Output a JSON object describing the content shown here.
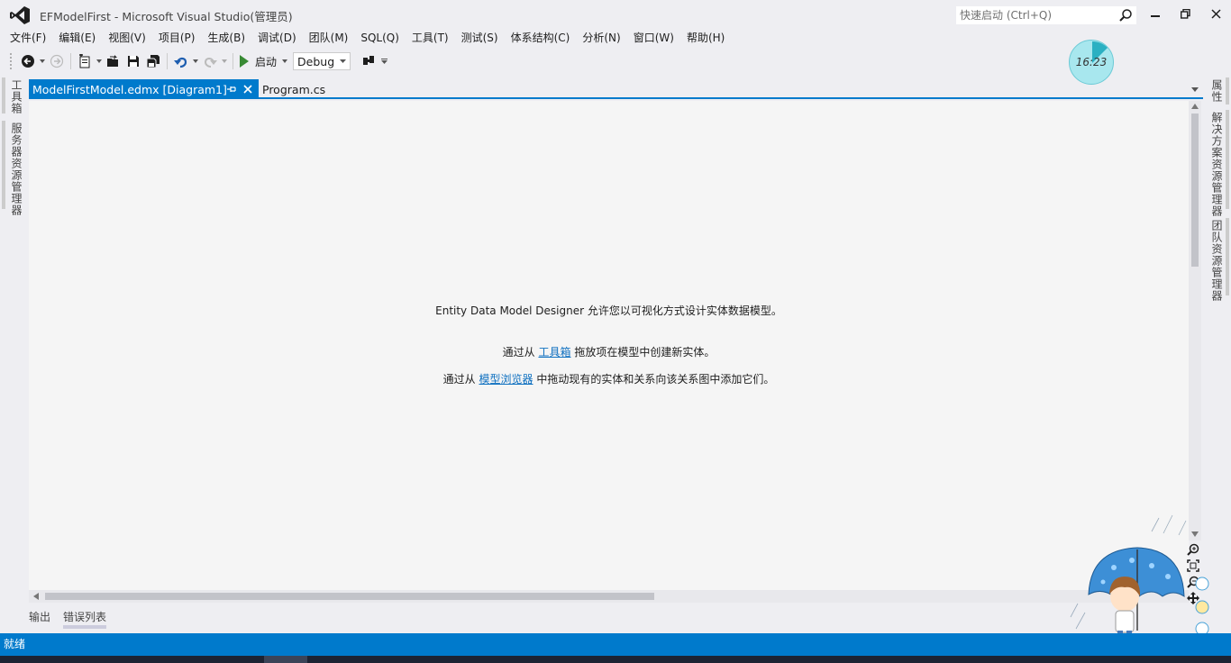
{
  "window": {
    "title": "EFModelFirst - Microsoft Visual Studio(管理员)",
    "quick_launch_placeholder": "快速启动 (Ctrl+Q)"
  },
  "menu": [
    "文件(F)",
    "编辑(E)",
    "视图(V)",
    "项目(P)",
    "生成(B)",
    "调试(D)",
    "团队(M)",
    "SQL(Q)",
    "工具(T)",
    "测试(S)",
    "体系结构(C)",
    "分析(N)",
    "窗口(W)",
    "帮助(H)"
  ],
  "toolbar": {
    "start_label": "启动",
    "configuration": "Debug"
  },
  "clock": {
    "time": "16:23"
  },
  "left_tool_windows": [
    "工具箱",
    "服务器资源管理器"
  ],
  "right_tool_windows": [
    "属性",
    "解决方案资源管理器",
    "团队资源管理器"
  ],
  "tabs": [
    {
      "label": "ModelFirstModel.edmx [Diagram1]",
      "active": true
    },
    {
      "label": "Program.cs",
      "active": false
    }
  ],
  "designer": {
    "line1": "Entity Data Model Designer 允许您以可视化方式设计实体数据模型。",
    "line2_prefix": "通过从 ",
    "line2_link": "工具箱",
    "line2_suffix": " 拖放项在模型中创建新实体。",
    "line3_prefix": "通过从 ",
    "line3_link": "模型浏览器",
    "line3_suffix": " 中拖动现有的实体和关系向该关系图中添加它们。"
  },
  "bottom_tabs": [
    "输出",
    "错误列表"
  ],
  "status": {
    "text": "就绪"
  },
  "colors": {
    "accent": "#007acc",
    "background": "#eeeef2",
    "designer": "#f5f5f5",
    "link": "#0e70c0"
  }
}
